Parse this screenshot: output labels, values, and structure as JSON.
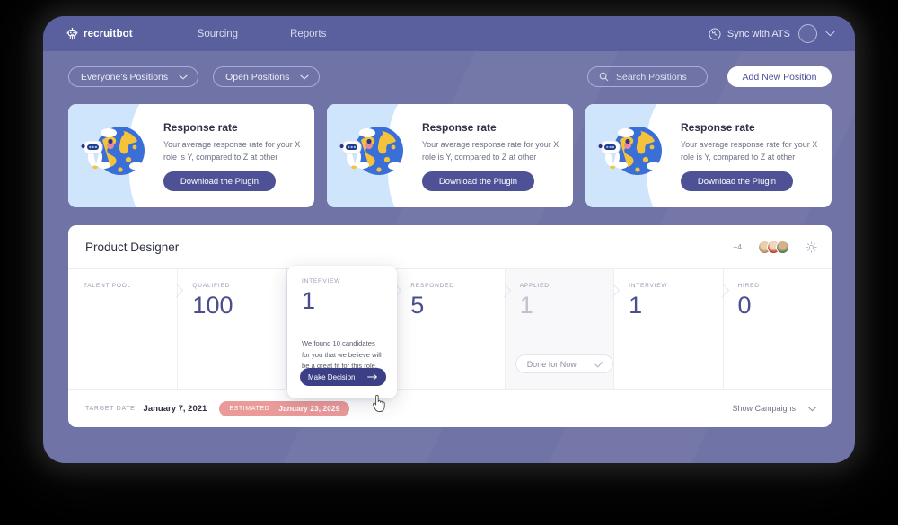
{
  "brand": {
    "name": "recruitbot",
    "icon": "robot-head-icon"
  },
  "nav": {
    "links": [
      "Sourcing",
      "Reports"
    ]
  },
  "topbar_right": {
    "sync_label": "Sync with ATS",
    "sync_icon": "refresh-circle-icon",
    "avatar_icon": "user-avatar",
    "chevron_icon": "chevron-down-icon"
  },
  "filters": {
    "owner_filter": "Everyone's Positions",
    "status_filter": "Open Positions",
    "chevron_icon": "chevron-down-icon",
    "search_placeholder": "Search Positions",
    "search_value": "",
    "search_icon": "search-icon",
    "add_button": "Add New Position"
  },
  "promo_cards": [
    {
      "title": "Response rate",
      "text": "Your average response rate for your X role is Y, compared to Z at other",
      "button": "Download the Plugin",
      "illustration": "robot-globe-illustration"
    },
    {
      "title": "Response rate",
      "text": "Your average response rate for your X role is Y, compared to Z at other",
      "button": "Download the Plugin",
      "illustration": "robot-globe-illustration"
    },
    {
      "title": "Response rate",
      "text": "Your average response rate for your X role is Y, compared to Z at other",
      "button": "Download the Plugin",
      "illustration": "robot-globe-illustration"
    }
  ],
  "panel": {
    "title": "Product Designer",
    "overflow_count": "+4",
    "settings_icon": "gear-icon",
    "stages": [
      {
        "label": "Talent Pool",
        "value": ""
      },
      {
        "label": "Qualified",
        "value": "100"
      },
      {
        "label": "Interview",
        "value": "1"
      },
      {
        "label": "Responded",
        "value": "5"
      },
      {
        "label": "Applied",
        "value": "1",
        "action": "Done for Now",
        "action_icon": "check-icon"
      },
      {
        "label": "Interview",
        "value": "1"
      },
      {
        "label": "Hired",
        "value": "0"
      }
    ],
    "popover": {
      "label": "Interview",
      "value": "1",
      "text": "We found 10 candidates for you that we believe will be a great fit for this role.",
      "button": "Make Decision",
      "button_icon": "arrow-right-icon"
    },
    "footer": {
      "target_label": "Target Date",
      "target_date": "January 7, 2021",
      "estimated_label": "Estimated",
      "estimated_date": "January 23, 2029",
      "campaigns_label": "Show Campaigns",
      "campaigns_icon": "chevron-down-icon"
    }
  },
  "colors": {
    "brand_purple": "#5a5f9e",
    "backdrop_purple": "#6f73a5",
    "accent_blue": "#4a4e8f",
    "estimated_pink": "#eb9a9a",
    "card_art_blue": "#cfe5fb"
  }
}
